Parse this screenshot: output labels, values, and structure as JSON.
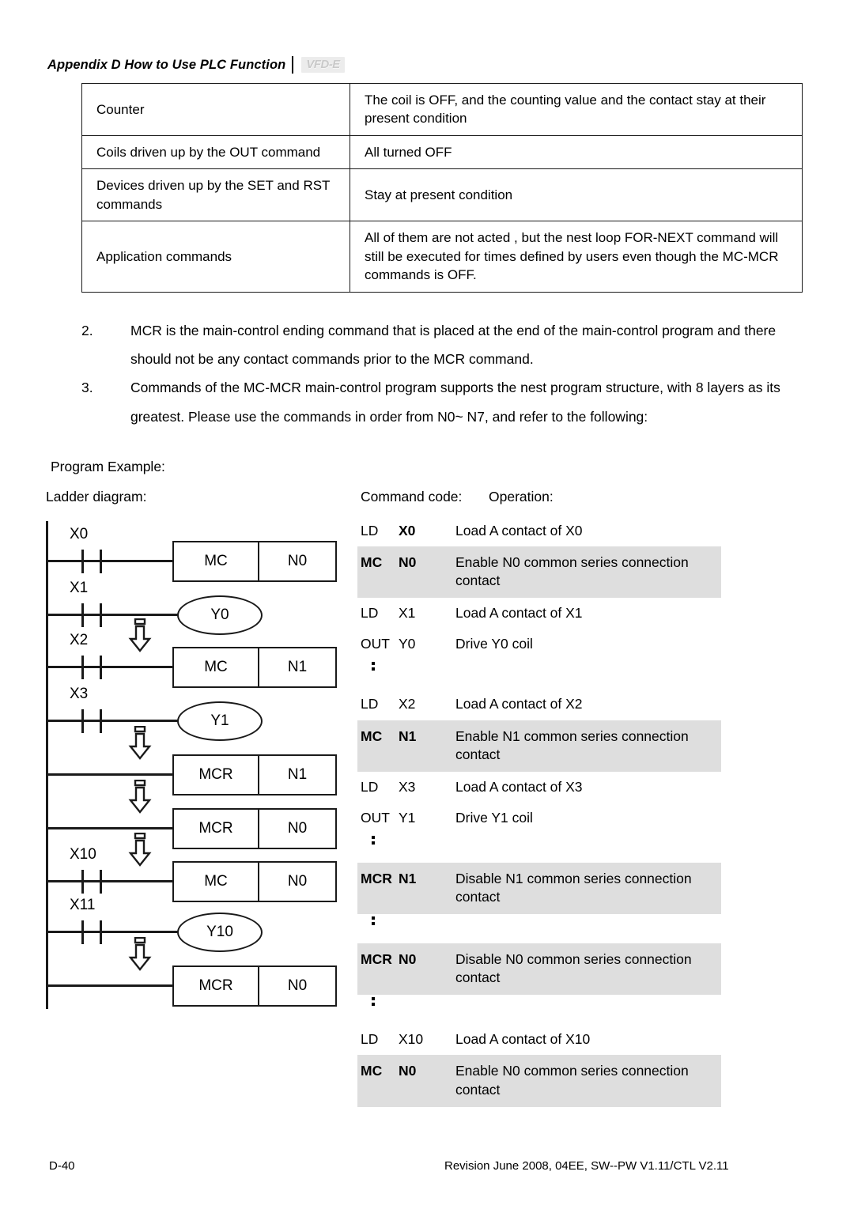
{
  "header": {
    "title": "Appendix D How to Use PLC Function",
    "logo": "VFD-E"
  },
  "state_table": {
    "rows": [
      {
        "item": "Counter",
        "state": "The coil is OFF, and the counting value and the contact stay at their present condition"
      },
      {
        "item": "Coils driven up by the OUT command",
        "state": "All turned OFF"
      },
      {
        "item": "Devices driven up by the SET and RST commands",
        "state": "Stay at present condition"
      },
      {
        "item": "Application commands",
        "state": "All of them are not acted , but the nest loop FOR-NEXT command will still be executed for times defined by users even though the MC-MCR commands is OFF."
      }
    ]
  },
  "notes": [
    {
      "num": "2.",
      "text": "MCR is the main-control ending command that is placed at the end of the main-control program and there should not be any contact commands prior to the MCR command."
    },
    {
      "num": "3.",
      "text": "Commands of the MC-MCR main-control program supports the nest program structure, with 8 layers as its greatest. Please use the commands in order from N0~ N7, and refer to the following:"
    }
  ],
  "captions": {
    "program_example": "Program Example:",
    "ladder_diagram": "Ladder diagram:",
    "command_code": "Command code:",
    "operation": "Operation:"
  },
  "ladder": {
    "rungs": [
      {
        "device": "X0",
        "has_contact": true,
        "block_type": "box",
        "op": "MC",
        "num": "N0"
      },
      {
        "device": "X1",
        "has_contact": true,
        "block_type": "coil",
        "op": "Y0",
        "num": ""
      },
      {
        "device": "X2",
        "has_contact": true,
        "block_type": "box",
        "op": "MC",
        "num": "N1"
      },
      {
        "device": "X3",
        "has_contact": true,
        "block_type": "coil",
        "op": "Y1",
        "num": ""
      },
      {
        "device": "",
        "has_contact": false,
        "block_type": "box",
        "op": "MCR",
        "num": "N1"
      },
      {
        "device": "",
        "has_contact": false,
        "block_type": "box",
        "op": "MCR",
        "num": "N0"
      },
      {
        "device": "X10",
        "has_contact": true,
        "block_type": "box",
        "op": "MC",
        "num": "N0"
      },
      {
        "device": "X11",
        "has_contact": true,
        "block_type": "coil",
        "op": "Y10",
        "num": ""
      },
      {
        "device": "",
        "has_contact": false,
        "block_type": "box",
        "op": "MCR",
        "num": "N0"
      }
    ],
    "arrow_icon": "down-block-arrow-icon"
  },
  "command_code": {
    "rows": [
      {
        "kind": "plain",
        "op": "LD",
        "device": "X0",
        "desc": "Load A contact of X0",
        "bold_device": true
      },
      {
        "kind": "hl",
        "op": "MC",
        "device": "N0",
        "desc": "Enable N0 common series connection contact",
        "bold": true
      },
      {
        "kind": "plain",
        "op": "LD",
        "device": "X1",
        "desc": "Load A contact of X1"
      },
      {
        "kind": "plain",
        "op": "OUT",
        "device": "Y0",
        "desc": "Drive Y0 coil"
      },
      {
        "kind": "ellipsis"
      },
      {
        "kind": "plain",
        "op": "LD",
        "device": "X2",
        "desc": "Load A contact of X2"
      },
      {
        "kind": "hl",
        "op": "MC",
        "device": "N1",
        "desc": "Enable N1 common series connection contact",
        "bold": true
      },
      {
        "kind": "plain",
        "op": "LD",
        "device": "X3",
        "desc": "Load A contact of X3"
      },
      {
        "kind": "plain",
        "op": "OUT",
        "device": "Y1",
        "desc": "Drive Y1 coil"
      },
      {
        "kind": "ellipsis"
      },
      {
        "kind": "hl",
        "op": "MCR",
        "device": "N1",
        "desc": "Disable N1 common series connection contact",
        "bold": true
      },
      {
        "kind": "ellipsis"
      },
      {
        "kind": "hl",
        "op": "MCR",
        "device": "N0",
        "desc": "Disable N0 common series connection contact",
        "bold": true
      },
      {
        "kind": "ellipsis"
      },
      {
        "kind": "plain",
        "op": "LD",
        "device": "X10",
        "desc": "Load A contact of X10"
      },
      {
        "kind": "hl",
        "op": "MC",
        "device": "N0",
        "desc": "Enable N0 common series connection contact",
        "bold": true
      }
    ]
  },
  "footer": {
    "page": "D-40",
    "revision": "Revision June 2008, 04EE, SW--PW V1.11/CTL V2.11"
  }
}
